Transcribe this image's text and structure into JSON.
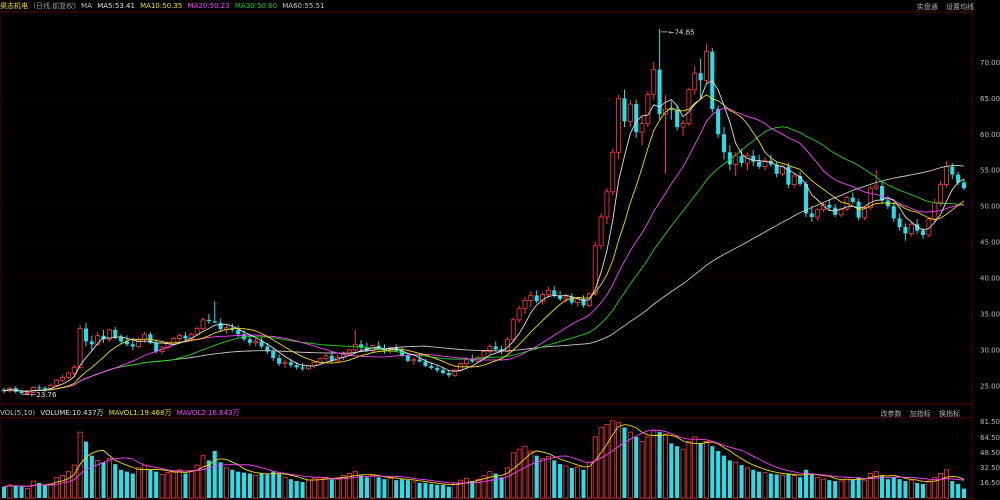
{
  "header": {
    "stock_name": "昊志机电",
    "period": "(日线,前复权)",
    "ma_label": "MA",
    "ma5": "MA5:53.41",
    "ma10": "MA10:50.35",
    "ma20": "MA20:50.23",
    "ma30": "MA30:50.60",
    "ma60": "MA60:55.51",
    "btn_realtime": "实盘通",
    "btn_settings": "设置均线"
  },
  "volume_panel": {
    "title": "VOL(5,10)",
    "volume": "VOLUME:10.437万",
    "mavol1": "MAVOL1:19.468万",
    "mavol2": "MAVOL2:16.643万",
    "btn_params": "改参数",
    "btn_add": "加指标",
    "btn_switch": "换指标"
  },
  "colors": {
    "up": "#ff3b3b",
    "down": "#28dce8",
    "ma5": "#e0e0e0",
    "ma10": "#f0e000",
    "ma20": "#ff40ff",
    "ma30": "#20d020",
    "ma60": "#c8c8c8",
    "grid": "#5a0000"
  },
  "chart_data": {
    "type": "candlestick",
    "price_axis": {
      "ticks": [
        "70.00",
        "65.00",
        "60.00",
        "55.00",
        "50.00",
        "45.00",
        "40.00",
        "35.00",
        "30.00",
        "25.00"
      ],
      "range": [
        22.5,
        77
      ]
    },
    "volume_axis": {
      "ticks": [
        "81.50",
        "64.50",
        "48.50",
        "32.50",
        "16.50"
      ],
      "range": [
        0,
        85
      ]
    },
    "annotations": {
      "high": "74.65",
      "low": "23.76"
    },
    "candles": [
      [
        24.5,
        24.8,
        24.0,
        24.3,
        12
      ],
      [
        24.3,
        24.9,
        24.1,
        24.7,
        14
      ],
      [
        24.7,
        25.0,
        24.0,
        24.2,
        13
      ],
      [
        24.2,
        24.5,
        23.8,
        24.0,
        12
      ],
      [
        24.0,
        24.3,
        23.8,
        24.1,
        10
      ],
      [
        24.1,
        25.0,
        24.0,
        24.8,
        18
      ],
      [
        24.8,
        25.2,
        24.5,
        24.7,
        16
      ],
      [
        24.7,
        25.0,
        24.2,
        24.5,
        14
      ],
      [
        24.5,
        25.3,
        24.4,
        25.1,
        15
      ],
      [
        25.1,
        26.0,
        24.9,
        25.8,
        22
      ],
      [
        25.8,
        26.5,
        25.5,
        26.2,
        24
      ],
      [
        26.2,
        27.0,
        26.0,
        26.8,
        28
      ],
      [
        26.8,
        28.0,
        26.5,
        27.6,
        35
      ],
      [
        27.6,
        33.5,
        27.4,
        33.0,
        70
      ],
      [
        33.0,
        33.8,
        30.5,
        31.2,
        60
      ],
      [
        31.2,
        32.0,
        30.0,
        30.8,
        45
      ],
      [
        30.8,
        32.5,
        30.6,
        32.0,
        40
      ],
      [
        32.0,
        32.8,
        31.0,
        31.5,
        38
      ],
      [
        31.5,
        33.0,
        31.2,
        32.8,
        42
      ],
      [
        32.8,
        33.2,
        31.5,
        31.8,
        36
      ],
      [
        31.8,
        32.2,
        30.8,
        31.2,
        30
      ],
      [
        31.2,
        32.0,
        30.5,
        30.8,
        28
      ],
      [
        30.8,
        31.5,
        30.0,
        30.5,
        26
      ],
      [
        30.5,
        31.8,
        30.3,
        31.5,
        32
      ],
      [
        31.5,
        32.5,
        31.0,
        32.2,
        35
      ],
      [
        32.2,
        32.5,
        30.8,
        31.0,
        30
      ],
      [
        31.0,
        31.5,
        29.5,
        29.8,
        28
      ],
      [
        29.8,
        30.6,
        29.4,
        30.4,
        25
      ],
      [
        30.4,
        31.2,
        30.1,
        31.0,
        27
      ],
      [
        31.0,
        31.8,
        30.7,
        31.6,
        28
      ],
      [
        31.6,
        32.3,
        31.2,
        32.0,
        30
      ],
      [
        32.0,
        32.5,
        31.4,
        31.6,
        26
      ],
      [
        31.6,
        32.4,
        31.3,
        32.2,
        29
      ],
      [
        32.2,
        33.2,
        32.0,
        33.0,
        35
      ],
      [
        33.0,
        34.5,
        32.8,
        34.2,
        45
      ],
      [
        34.2,
        35.0,
        33.6,
        34.0,
        40
      ],
      [
        34.0,
        36.8,
        33.8,
        33.8,
        50
      ],
      [
        33.8,
        34.4,
        32.5,
        32.9,
        38
      ],
      [
        32.9,
        33.5,
        32.3,
        33.1,
        32
      ],
      [
        33.1,
        33.7,
        32.5,
        32.8,
        30
      ],
      [
        32.8,
        33.4,
        31.8,
        32.2,
        28
      ],
      [
        32.2,
        32.8,
        31.2,
        31.5,
        27
      ],
      [
        31.5,
        32.0,
        30.6,
        31.0,
        26
      ],
      [
        31.0,
        31.6,
        30.5,
        31.2,
        24
      ],
      [
        31.2,
        31.8,
        30.2,
        30.5,
        26
      ],
      [
        30.5,
        31.0,
        29.5,
        29.8,
        25
      ],
      [
        29.8,
        30.3,
        28.5,
        28.9,
        28
      ],
      [
        28.9,
        29.4,
        27.8,
        28.1,
        26
      ],
      [
        28.1,
        28.7,
        27.5,
        28.3,
        22
      ],
      [
        28.3,
        28.8,
        27.6,
        27.9,
        20
      ],
      [
        27.9,
        28.3,
        27.3,
        27.6,
        18
      ],
      [
        27.6,
        28.2,
        27.1,
        27.4,
        17
      ],
      [
        27.4,
        28.0,
        27.2,
        27.8,
        19
      ],
      [
        27.8,
        28.5,
        27.5,
        28.3,
        21
      ],
      [
        28.3,
        29.0,
        28.0,
        28.8,
        22
      ],
      [
        28.8,
        29.5,
        28.5,
        29.2,
        22
      ],
      [
        29.2,
        29.6,
        28.2,
        28.5,
        20
      ],
      [
        28.5,
        29.3,
        28.3,
        29.0,
        21
      ],
      [
        29.0,
        29.8,
        28.6,
        29.5,
        24
      ],
      [
        29.5,
        30.2,
        29.2,
        30.0,
        26
      ],
      [
        30.0,
        32.8,
        29.8,
        30.8,
        28
      ],
      [
        30.8,
        31.4,
        30.0,
        30.3,
        24
      ],
      [
        30.3,
        31.0,
        29.7,
        29.9,
        22
      ],
      [
        29.9,
        30.8,
        29.7,
        30.6,
        24
      ],
      [
        30.6,
        31.2,
        30.0,
        30.2,
        22
      ],
      [
        30.2,
        30.8,
        29.5,
        29.8,
        20
      ],
      [
        29.8,
        30.5,
        29.5,
        30.3,
        21
      ],
      [
        30.3,
        30.8,
        29.7,
        29.9,
        19
      ],
      [
        29.9,
        30.3,
        29.0,
        29.2,
        20
      ],
      [
        29.2,
        29.6,
        28.3,
        28.5,
        19
      ],
      [
        28.5,
        29.0,
        28.0,
        28.7,
        17
      ],
      [
        28.7,
        29.2,
        28.3,
        28.4,
        16
      ],
      [
        28.4,
        28.8,
        27.6,
        27.8,
        16
      ],
      [
        27.8,
        28.2,
        27.3,
        27.5,
        15
      ],
      [
        27.5,
        27.9,
        26.9,
        27.2,
        14
      ],
      [
        27.2,
        27.6,
        26.6,
        26.8,
        14
      ],
      [
        26.8,
        27.2,
        26.2,
        26.5,
        12
      ],
      [
        26.5,
        27.4,
        26.3,
        27.2,
        16
      ],
      [
        27.2,
        28.3,
        27.0,
        28.1,
        19
      ],
      [
        28.1,
        29.0,
        27.8,
        28.7,
        21
      ],
      [
        28.7,
        29.4,
        28.2,
        28.4,
        18
      ],
      [
        28.4,
        29.2,
        28.2,
        29.0,
        20
      ],
      [
        29.0,
        30.0,
        28.8,
        29.8,
        24
      ],
      [
        29.8,
        30.8,
        29.5,
        30.5,
        28
      ],
      [
        30.5,
        31.2,
        29.8,
        30.1,
        26
      ],
      [
        30.1,
        30.6,
        29.4,
        29.8,
        22
      ],
      [
        29.8,
        31.8,
        29.7,
        31.5,
        32
      ],
      [
        31.5,
        34.5,
        31.3,
        34.2,
        48
      ],
      [
        34.2,
        36.2,
        33.8,
        35.8,
        52
      ],
      [
        35.8,
        37.4,
        35.0,
        36.9,
        55
      ],
      [
        36.9,
        38.2,
        36.0,
        37.6,
        50
      ],
      [
        37.6,
        38.3,
        36.5,
        36.8,
        45
      ],
      [
        36.8,
        38.0,
        36.3,
        37.7,
        42
      ],
      [
        37.7,
        38.8,
        37.2,
        38.3,
        44
      ],
      [
        38.3,
        38.9,
        37.3,
        37.6,
        40
      ],
      [
        37.6,
        38.2,
        36.8,
        37.1,
        36
      ],
      [
        37.1,
        37.8,
        36.6,
        37.4,
        34
      ],
      [
        37.4,
        37.9,
        36.3,
        36.6,
        32
      ],
      [
        36.6,
        37.4,
        36.0,
        37.1,
        33
      ],
      [
        37.1,
        37.6,
        35.9,
        36.2,
        30
      ],
      [
        36.2,
        38.0,
        36.0,
        37.8,
        38
      ],
      [
        37.8,
        45.0,
        37.5,
        44.5,
        65
      ],
      [
        44.5,
        49.0,
        44.0,
        48.5,
        75
      ],
      [
        48.5,
        52.5,
        47.5,
        52.0,
        78
      ],
      [
        52.0,
        58.0,
        51.5,
        57.5,
        82
      ],
      [
        57.5,
        65.5,
        56.5,
        65.0,
        80
      ],
      [
        65.0,
        66.2,
        61.0,
        61.8,
        75
      ],
      [
        61.8,
        64.8,
        61.0,
        64.2,
        70
      ],
      [
        64.2,
        64.8,
        59.5,
        60.3,
        65
      ],
      [
        60.3,
        62.5,
        58.5,
        61.5,
        60
      ],
      [
        61.5,
        66.0,
        61.0,
        65.5,
        65
      ],
      [
        65.5,
        70.0,
        64.8,
        69.0,
        72
      ],
      [
        69.0,
        74.65,
        62.0,
        62.8,
        70
      ],
      [
        62.8,
        65.5,
        54.5,
        63.5,
        68
      ],
      [
        63.5,
        64.6,
        62.0,
        63.4,
        58
      ],
      [
        63.4,
        64.0,
        60.5,
        61.0,
        55
      ],
      [
        61.0,
        62.0,
        59.8,
        61.5,
        52
      ],
      [
        61.5,
        66.5,
        61.2,
        66.2,
        60
      ],
      [
        66.2,
        69.5,
        65.5,
        68.5,
        65
      ],
      [
        68.5,
        70.5,
        65.0,
        67.5,
        58
      ],
      [
        67.5,
        72.5,
        67.0,
        71.5,
        60
      ],
      [
        71.5,
        72.0,
        63.0,
        63.5,
        55
      ],
      [
        63.5,
        64.0,
        59.5,
        60.0,
        50
      ],
      [
        60.0,
        61.0,
        56.5,
        57.5,
        45
      ],
      [
        57.5,
        58.5,
        55.0,
        55.8,
        40
      ],
      [
        55.8,
        57.5,
        54.2,
        57.0,
        38
      ],
      [
        57.0,
        58.0,
        55.5,
        56.0,
        35
      ],
      [
        56.0,
        57.5,
        55.0,
        57.0,
        32
      ],
      [
        57.0,
        57.8,
        55.6,
        56.2,
        30
      ],
      [
        56.2,
        57.2,
        55.2,
        55.5,
        28
      ],
      [
        55.5,
        56.8,
        55.0,
        56.3,
        27
      ],
      [
        56.3,
        57.2,
        55.5,
        55.8,
        26
      ],
      [
        55.8,
        56.2,
        54.0,
        54.5,
        25
      ],
      [
        54.5,
        55.8,
        54.2,
        55.5,
        24
      ],
      [
        55.5,
        56.0,
        52.5,
        53.0,
        26
      ],
      [
        53.0,
        54.5,
        52.6,
        54.2,
        24
      ],
      [
        54.2,
        54.8,
        52.8,
        53.1,
        22
      ],
      [
        53.1,
        53.5,
        48.5,
        49.0,
        30
      ],
      [
        49.0,
        50.0,
        47.8,
        48.5,
        25
      ],
      [
        48.5,
        49.8,
        48.0,
        49.5,
        22
      ],
      [
        49.5,
        50.5,
        49.2,
        50.2,
        20
      ],
      [
        50.2,
        51.0,
        49.5,
        49.8,
        19
      ],
      [
        49.8,
        50.3,
        48.5,
        48.8,
        18
      ],
      [
        48.8,
        49.8,
        48.5,
        49.6,
        18
      ],
      [
        49.6,
        51.5,
        49.3,
        51.2,
        22
      ],
      [
        51.2,
        51.9,
        50.3,
        50.6,
        20
      ],
      [
        50.6,
        51.0,
        48.0,
        48.4,
        22
      ],
      [
        48.4,
        50.0,
        48.1,
        49.8,
        19
      ],
      [
        49.8,
        52.8,
        49.5,
        52.5,
        26
      ],
      [
        52.5,
        55.0,
        52.2,
        52.8,
        28
      ],
      [
        52.8,
        53.5,
        50.3,
        50.8,
        24
      ],
      [
        50.8,
        51.4,
        49.6,
        50.0,
        20
      ],
      [
        50.0,
        50.6,
        47.8,
        48.3,
        22
      ],
      [
        48.3,
        49.0,
        46.6,
        47.1,
        20
      ],
      [
        47.1,
        47.6,
        45.2,
        46.2,
        18
      ],
      [
        46.2,
        47.8,
        45.8,
        47.5,
        19
      ],
      [
        47.5,
        48.2,
        46.2,
        46.6,
        16
      ],
      [
        46.6,
        47.0,
        45.5,
        46.0,
        15
      ],
      [
        46.0,
        48.5,
        45.7,
        48.2,
        18
      ],
      [
        48.2,
        51.0,
        47.8,
        50.5,
        22
      ],
      [
        50.5,
        53.5,
        50.0,
        53.0,
        26
      ],
      [
        53.0,
        56.3,
        52.6,
        55.5,
        30
      ],
      [
        55.5,
        56.0,
        53.8,
        54.4,
        18
      ],
      [
        54.4,
        54.8,
        52.9,
        53.3,
        15
      ],
      [
        53.3,
        53.8,
        52.2,
        52.5,
        10
      ]
    ]
  }
}
